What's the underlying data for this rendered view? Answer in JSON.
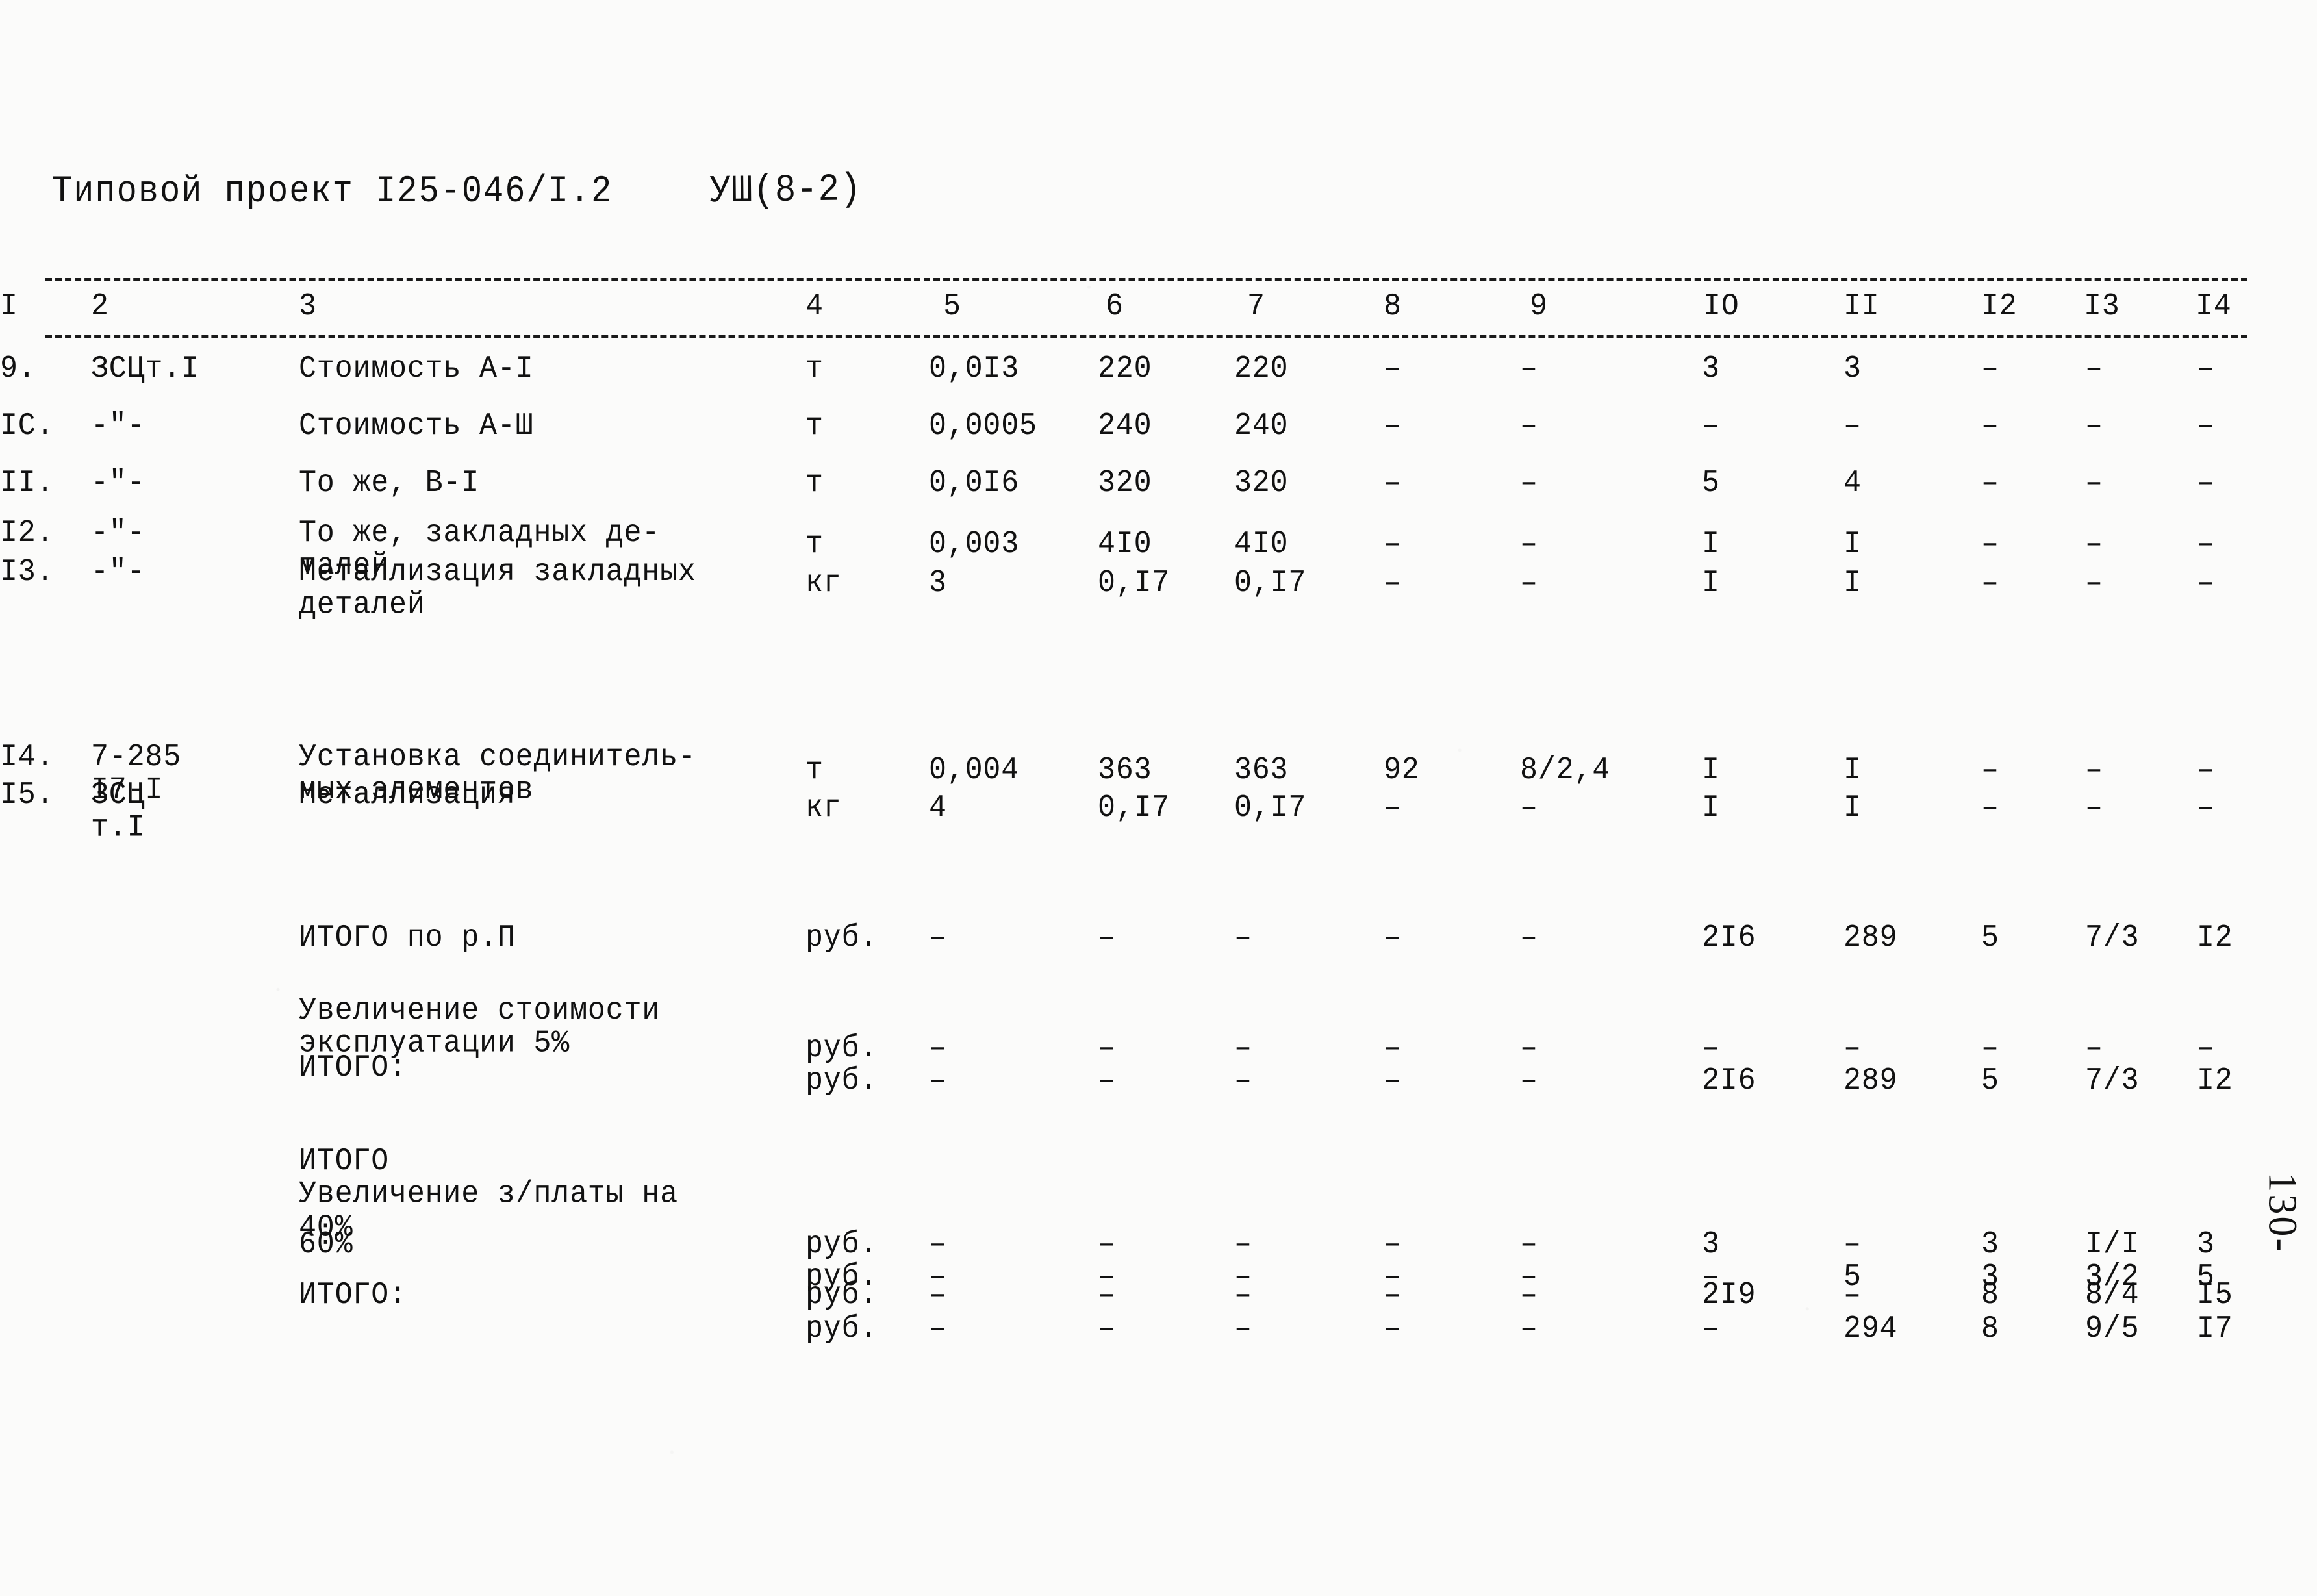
{
  "header": {
    "project_label": "Типовой проект I25-046/I.2",
    "sheet_code": "УШ(8-2)"
  },
  "table": {
    "column_headers": [
      "I",
      "2",
      "3",
      "4",
      "5",
      "6",
      "7",
      "8",
      "9",
      "IO",
      "II",
      "I2",
      "I3",
      "I4"
    ],
    "rows": [
      {
        "num": "9.",
        "code": "ЗСЦт.I",
        "desc": "Стоимость А-I",
        "unit": "т",
        "c5": "0,0I3",
        "c6": "220",
        "c7": "220",
        "c8": "–",
        "c9": "–",
        "c10": "3",
        "c11": "3",
        "c12": "–",
        "c13": "–",
        "c14": "–"
      },
      {
        "num": "IC.",
        "code": "-\"-",
        "desc": "Стоимость А-Ш",
        "unit": "т",
        "c5": "0,0005",
        "c6": "240",
        "c7": "240",
        "c8": "–",
        "c9": "–",
        "c10": "–",
        "c11": "–",
        "c12": "–",
        "c13": "–",
        "c14": "–"
      },
      {
        "num": "II.",
        "code": "-\"-",
        "desc": "То же, В-I",
        "unit": "т",
        "c5": "0,0I6",
        "c6": "320",
        "c7": "320",
        "c8": "–",
        "c9": "–",
        "c10": "5",
        "c11": "4",
        "c12": "–",
        "c13": "–",
        "c14": "–"
      },
      {
        "num": "I2.",
        "code": "-\"-",
        "desc": "То же, закладных де-\nталей",
        "unit": "т",
        "c5": "0,003",
        "c6": "4I0",
        "c7": "4I0",
        "c8": "–",
        "c9": "–",
        "c10": "I",
        "c11": "I",
        "c12": "–",
        "c13": "–",
        "c14": "–"
      },
      {
        "num": "I3.",
        "code": "-\"-",
        "desc": "Металлизация закладных\nдеталей",
        "unit": "кг",
        "c5": "3",
        "c6": "0,I7",
        "c7": "0,I7",
        "c8": "–",
        "c9": "–",
        "c10": "I",
        "c11": "I",
        "c12": "–",
        "c13": "–",
        "c14": "–"
      },
      {
        "num": "I4.",
        "code": "7-285\nI7-I",
        "desc": "Установка соединитель-\nных элементов",
        "unit": "т",
        "c5": "0,004",
        "c6": "363",
        "c7": "363",
        "c8": "92",
        "c9": "8/2,4",
        "c10": "I",
        "c11": "I",
        "c12": "–",
        "c13": "–",
        "c14": "–"
      },
      {
        "num": "I5.",
        "code": "ЗСЦ\nт.I",
        "desc": "Металлизация",
        "unit": "кг",
        "c5": "4",
        "c6": "0,I7",
        "c7": "0,I7",
        "c8": "–",
        "c9": "–",
        "c10": "I",
        "c11": "I",
        "c12": "–",
        "c13": "–",
        "c14": "–"
      }
    ],
    "summary_rows": [
      {
        "label": "ИТОГО по р.П",
        "unit": "руб.",
        "c5": "–",
        "c6": "–",
        "c7": "–",
        "c8": "–",
        "c9": "–",
        "c10": "2I6",
        "c11": "289",
        "c12": "5",
        "c13": "7/3",
        "c14": "I2"
      },
      {
        "label": "Увеличение стоимости\nэксплуатации 5%",
        "unit": "руб.",
        "c5": "–",
        "c6": "–",
        "c7": "–",
        "c8": "–",
        "c9": "–",
        "c10": "–",
        "c11": "–",
        "c12": "–",
        "c13": "–",
        "c14": "–"
      },
      {
        "label": "ИТОГО:",
        "unit": "руб.",
        "c5": "–",
        "c6": "–",
        "c7": "–",
        "c8": "–",
        "c9": "–",
        "c10": "2I6",
        "c11": "289",
        "c12": "5",
        "c13": "7/3",
        "c14": "I2"
      },
      {
        "label": "ИТОГО\nУвеличение з/платы на\n40%",
        "unit": "руб.",
        "c5": "–",
        "c6": "–",
        "c7": "–",
        "c8": "–",
        "c9": "–",
        "c10": "3",
        "c11": "–",
        "c12": "3",
        "c13": "I/I",
        "c14": "3"
      },
      {
        "label": "60%",
        "unit": "руб.",
        "c5": "–",
        "c6": "–",
        "c7": "–",
        "c8": "–",
        "c9": "–",
        "c10": "–",
        "c11": "5",
        "c12": "3",
        "c13": "3/2",
        "c14": "5"
      },
      {
        "label": "ИТОГО:",
        "unit": "руб.",
        "c5": "–",
        "c6": "–",
        "c7": "–",
        "c8": "–",
        "c9": "–",
        "c10": "2I9",
        "c11": "–",
        "c12": "8",
        "c13": "8/4",
        "c14": "I5"
      },
      {
        "label": "",
        "unit": "руб.",
        "c5": "–",
        "c6": "–",
        "c7": "–",
        "c8": "–",
        "c9": "–",
        "c10": "–",
        "c11": "294",
        "c12": "8",
        "c13": "9/5",
        "c14": "I7"
      }
    ]
  },
  "page_number": "130-"
}
